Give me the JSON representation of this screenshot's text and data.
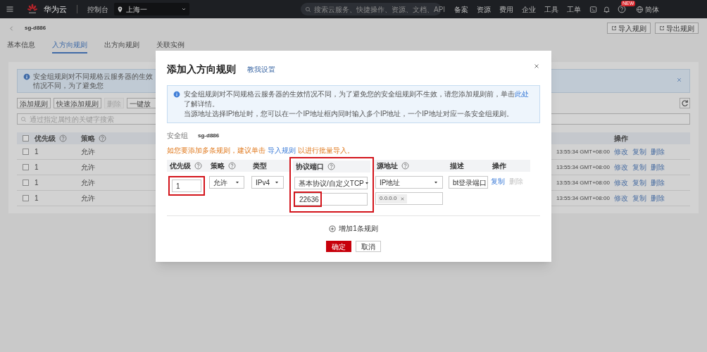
{
  "topbar": {
    "brand": "华为云",
    "console": "控制台",
    "region": "上海一",
    "search_placeholder": "搜索云服务、快捷操作、资源、文档、API",
    "nav": [
      "备案",
      "资源",
      "费用",
      "企业",
      "工具",
      "工单"
    ],
    "help_badge": "NEW",
    "language": "简体"
  },
  "header": {
    "title": "sg-d886",
    "actions": [
      "导入规则",
      "导出规则"
    ],
    "tabs": [
      {
        "label": "基本信息",
        "selected": false
      },
      {
        "label": "入方向规则",
        "selected": true
      },
      {
        "label": "出方向规则",
        "selected": false
      },
      {
        "label": "关联实例",
        "selected": false
      }
    ]
  },
  "rules_panel": {
    "alert": "安全组规则对不同规格云服务器的生效情况不同，为了避免您",
    "toolbar": [
      {
        "label": "添加规则",
        "disabled": false
      },
      {
        "label": "快速添加规则",
        "disabled": false
      },
      {
        "label": "删除",
        "disabled": true
      },
      {
        "label": "一键放",
        "disabled": false
      }
    ],
    "search_placeholder": "通过指定属性的关键字搜索",
    "all_checked": false,
    "columns": [
      {
        "label": "优先级",
        "help": true
      },
      {
        "label": "策略",
        "help": true
      }
    ],
    "actions_column": "操作",
    "rows": [
      {
        "checked": false,
        "priority": "1",
        "policy": "允许",
        "time": "13:55:34 GMT+08:00",
        "links": [
          "修改",
          "复制",
          "删除"
        ]
      },
      {
        "checked": false,
        "priority": "1",
        "policy": "允许",
        "time": "13:55:34 GMT+08:00",
        "links": [
          "修改",
          "复制",
          "删除"
        ]
      },
      {
        "checked": false,
        "priority": "1",
        "policy": "允许",
        "time": "13:55:34 GMT+08:00",
        "links": [
          "修改",
          "复制",
          "删除"
        ]
      },
      {
        "checked": false,
        "priority": "1",
        "policy": "允许",
        "time": "13:55:34 GMT+08:00",
        "links": [
          "修改",
          "复制",
          "删除"
        ]
      }
    ]
  },
  "dialog": {
    "title": "添加入方向规则",
    "help_link": "教我设置",
    "notice": [
      {
        "before": "安全组规则对不同规格云服务器的生效情况不同，为了避免您的安全组规则不生效，请您添加规则前，单击",
        "link": "此处",
        "after": "了解详情。"
      },
      {
        "before": "当源地址选择IP地址时，您可以在一个IP地址框内同时输入多个IP地址，一个IP地址对应一条安全组规则。"
      }
    ],
    "security_group": {
      "label": "安全组",
      "value": "sg-d886"
    },
    "hint": {
      "before": "如您要添加多条规则，建议单击 ",
      "link": "导入规则",
      "after": " 以进行批量导入。"
    },
    "columns": [
      {
        "label": "优先级",
        "help": true,
        "highlighted": false
      },
      {
        "label": "策略",
        "help": true,
        "highlighted": false
      },
      {
        "label": "类型",
        "help": false,
        "highlighted": false
      },
      {
        "label": "协议端口",
        "help": true,
        "highlighted": true
      },
      {
        "label": "源地址",
        "help": true,
        "highlighted": false
      },
      {
        "label": "描述",
        "help": false,
        "highlighted": false
      },
      {
        "label": "操作",
        "help": false,
        "highlighted": false
      }
    ],
    "rule": {
      "priority": {
        "value": "1",
        "highlighted": true
      },
      "policy": "允许",
      "type": "IPv4",
      "protocol": "基本协议/自定义TCP",
      "port": {
        "value": "22636",
        "highlighted": true
      },
      "source_type": "IP地址",
      "source_tags": [
        "0.0.0.0"
      ],
      "description": "bt登录端口",
      "actions": [
        {
          "label": "复制",
          "disabled": false
        },
        {
          "label": "删除",
          "disabled": true
        }
      ]
    },
    "add_label": "增加1条规则",
    "buttons": [
      {
        "label": "确定",
        "kind": "primary"
      },
      {
        "label": "取消",
        "kind": "default"
      }
    ]
  }
}
